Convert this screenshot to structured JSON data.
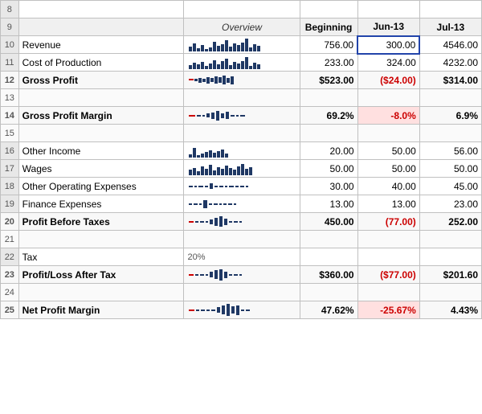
{
  "rows": [
    {
      "num": "8",
      "type": "empty"
    },
    {
      "num": "9",
      "type": "header",
      "col_label": "",
      "overview": "Overview",
      "beginning": "Beginning",
      "jun": "Jun-13",
      "jul": "Jul-13"
    },
    {
      "num": "10",
      "type": "data",
      "label": "Revenue",
      "spark": "bars",
      "beginning": "756.00",
      "jun": "300.00",
      "jul": "4546.00",
      "jun_selected": true
    },
    {
      "num": "11",
      "type": "data",
      "label": "Cost of Production",
      "spark": "bars",
      "beginning": "233.00",
      "jun": "324.00",
      "jul": "4232.00"
    },
    {
      "num": "12",
      "type": "bold_line",
      "label": "Gross Profit",
      "spark": "bars_neg",
      "beginning": "$523.00",
      "jun": "($24.00)",
      "jul": "$314.00",
      "jun_neg": true
    },
    {
      "num": "13",
      "type": "empty"
    },
    {
      "num": "14",
      "type": "bold",
      "label": "Gross Profit Margin",
      "spark": "bars_neg2",
      "beginning": "69.2%",
      "jun": "-8.0%",
      "jul": "6.9%",
      "jun_neg": true
    },
    {
      "num": "15",
      "type": "empty"
    },
    {
      "num": "16",
      "type": "data",
      "label": "Other Income",
      "spark": "bars_sm",
      "beginning": "20.00",
      "jun": "50.00",
      "jul": "56.00"
    },
    {
      "num": "17",
      "type": "data",
      "label": "Wages",
      "spark": "bars_med",
      "beginning": "50.00",
      "jun": "50.00",
      "jul": "50.00"
    },
    {
      "num": "18",
      "type": "data",
      "label": "Other Operating Expenses",
      "spark": "dashes",
      "beginning": "30.00",
      "jun": "40.00",
      "jul": "45.00"
    },
    {
      "num": "19",
      "type": "data",
      "label": "Finance Expenses",
      "spark": "bars_fin",
      "beginning": "13.00",
      "jun": "13.00",
      "jul": "23.00"
    },
    {
      "num": "20",
      "type": "profit_before",
      "label": "Profit Before Taxes",
      "spark": "bars_pbt",
      "beginning": "450.00",
      "jun": "(77.00)",
      "jul": "252.00",
      "jun_neg": true
    },
    {
      "num": "21",
      "type": "empty"
    },
    {
      "num": "22",
      "type": "tax",
      "label": "Tax",
      "tax_pct": "20%"
    },
    {
      "num": "23",
      "type": "after_tax",
      "label": "Profit/Loss After Tax",
      "spark": "bars_at",
      "beginning": "$360.00",
      "jun": "($77.00)",
      "jul": "$201.60",
      "jun_neg": true
    },
    {
      "num": "24",
      "type": "empty"
    },
    {
      "num": "25",
      "type": "net_margin",
      "label": "Net Profit Margin",
      "spark": "bars_nm",
      "beginning": "47.62%",
      "jun": "-25.67%",
      "jul": "4.43%",
      "jun_neg": true
    }
  ]
}
